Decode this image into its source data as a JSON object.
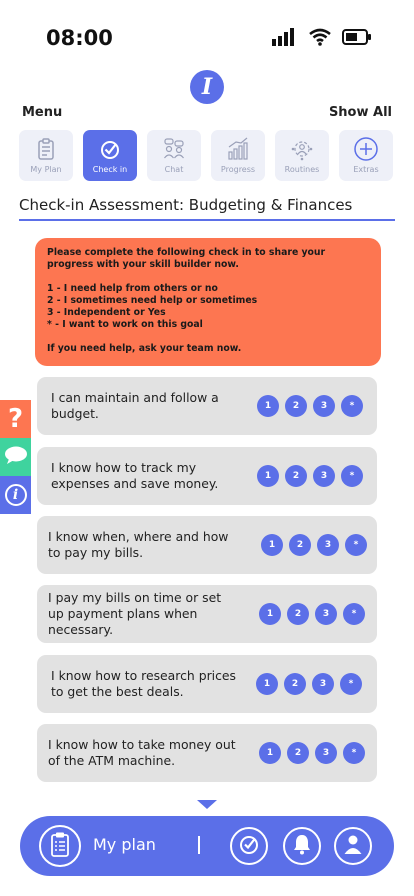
{
  "status": {
    "time": "08:00"
  },
  "app": {
    "logo_letter": "I"
  },
  "menu": {
    "label": "Menu",
    "show_all": "Show All"
  },
  "tabs": [
    {
      "label": "My Plan",
      "icon": "clipboard-icon",
      "active": false
    },
    {
      "label": "Check in",
      "icon": "check-circle-icon",
      "active": true
    },
    {
      "label": "Chat",
      "icon": "chat-people-icon",
      "active": false
    },
    {
      "label": "Progress",
      "icon": "progress-chart-icon",
      "active": false
    },
    {
      "label": "Routines",
      "icon": "routines-icon",
      "active": false
    },
    {
      "label": "Extras",
      "icon": "plus-circle-icon",
      "active": false
    }
  ],
  "page": {
    "title": "Check-in Assessment: Budgeting & Finances"
  },
  "notice": {
    "intro": "Please complete the following check in to share your progress with your skill builder now.",
    "scale": [
      "1 - I need help from others or no",
      "2 - I sometimes need help or sometimes",
      "3 - Independent or Yes",
      "* - I want to work on this goal"
    ],
    "help": "If you need help, ask your team now."
  },
  "side_tabs": [
    {
      "glyph": "?",
      "icon": "question-icon",
      "color": "#fd7651"
    },
    {
      "glyph": "",
      "icon": "chat-bubble-icon",
      "color": "#3fd39e"
    },
    {
      "glyph": "i",
      "icon": "info-icon",
      "color": "#5b6fe8"
    }
  ],
  "rating_options": [
    "1",
    "2",
    "3",
    "*"
  ],
  "questions": [
    {
      "text": "I can maintain and follow a budget."
    },
    {
      "text": "I know how to track my expenses and save money."
    },
    {
      "text": "I know when, where and how to pay my bills."
    },
    {
      "text": "I pay my bills on time or set up payment plans when necessary."
    },
    {
      "text": "I know how to research prices to get the best deals."
    },
    {
      "text": "I know how to take money out of the ATM machine."
    }
  ],
  "bottom_nav": {
    "plan_label": "My plan",
    "divider": "|"
  },
  "colors": {
    "accent": "#5b6fe8",
    "notice": "#fd7651",
    "card": "#e2e2e2",
    "chat_green": "#3fd39e"
  }
}
